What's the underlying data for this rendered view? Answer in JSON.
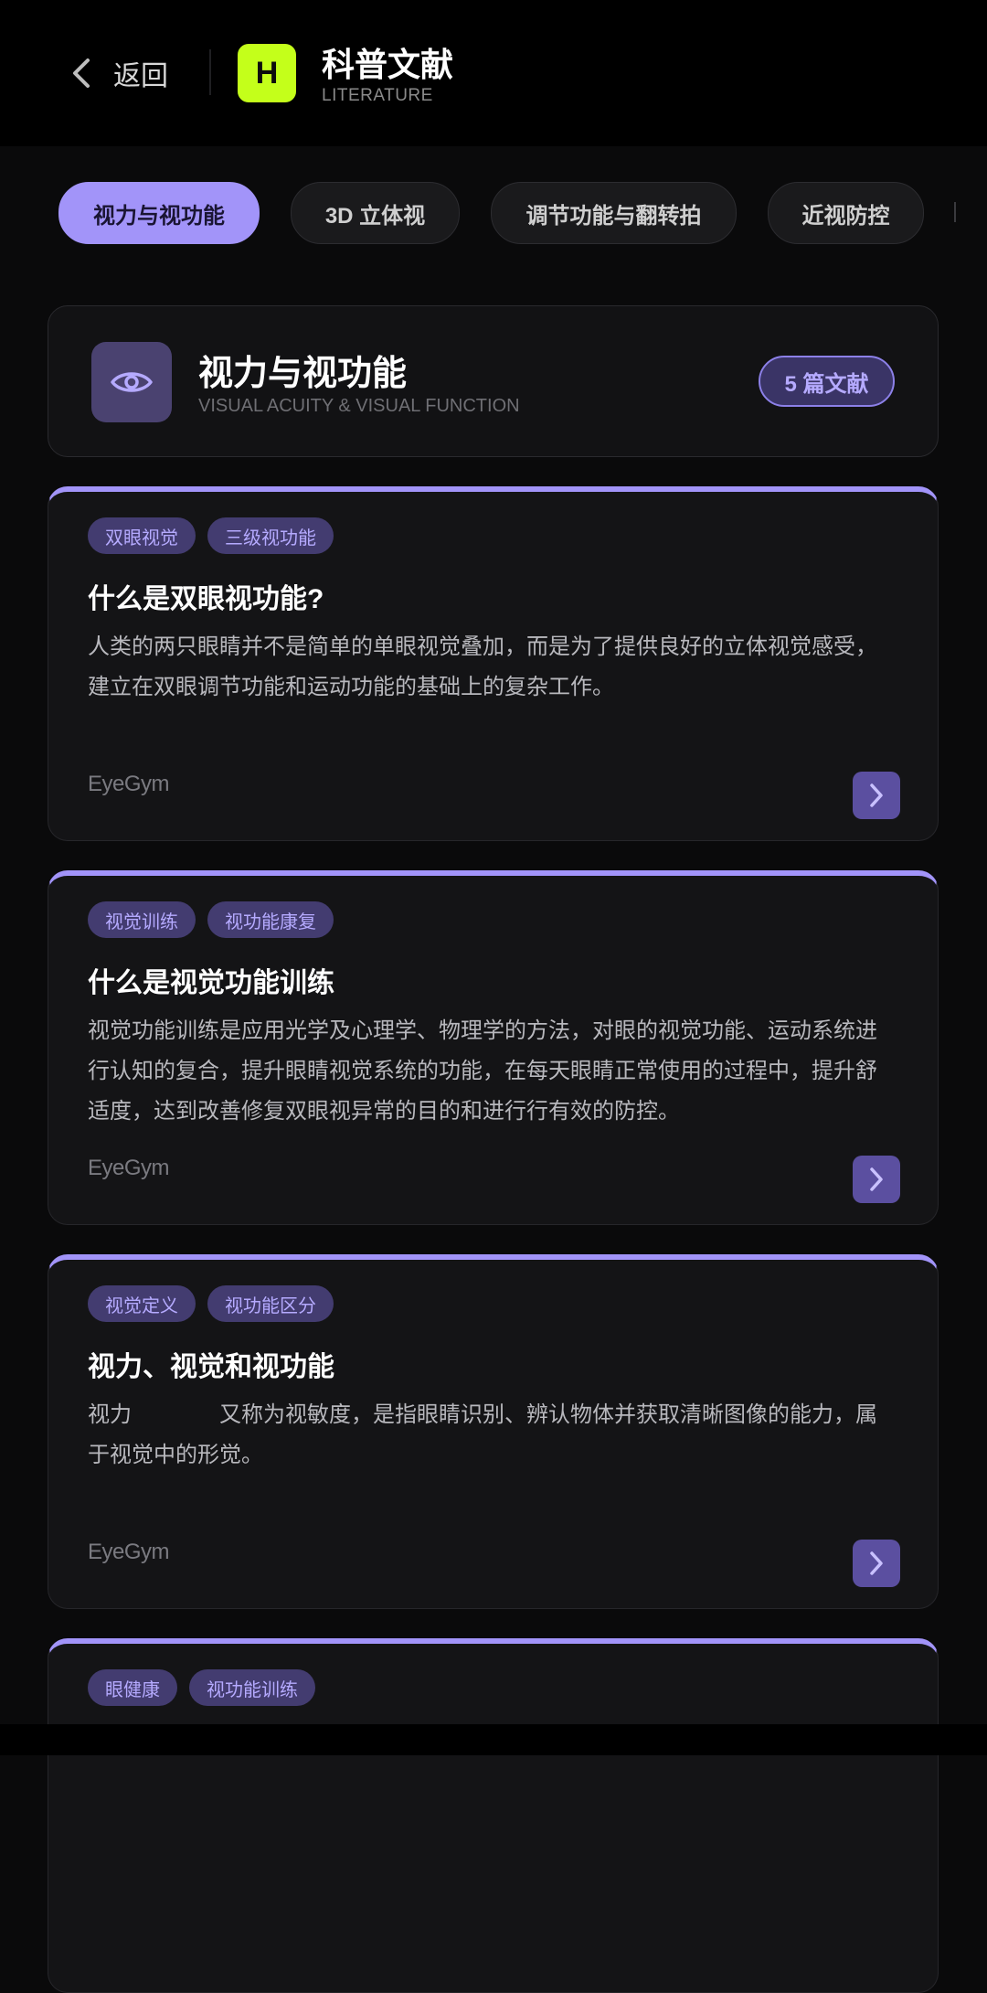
{
  "header": {
    "back_label": "返回",
    "logo_letter": "H",
    "title": "科普文献",
    "subtitle": "LITERATURE"
  },
  "colors": {
    "accent": "#a294f9",
    "logo": "#c4ff1a",
    "background": "#0a0a0b"
  },
  "tabs": [
    {
      "label": "视力与视功能",
      "active": true
    },
    {
      "label": "3D 立体视",
      "active": false
    },
    {
      "label": "调节功能与翻转拍",
      "active": false
    },
    {
      "label": "近视防控",
      "active": false
    }
  ],
  "category": {
    "icon": "eye-icon",
    "title": "视力与视功能",
    "subtitle": "VISUAL ACUITY & VISUAL FUNCTION",
    "count_badge": "5 篇文献"
  },
  "articles": [
    {
      "tags": [
        "双眼视觉",
        "三级视功能"
      ],
      "title": "什么是双眼视功能?",
      "body": "人类的两只眼睛并不是简单的单眼视觉叠加，而是为了提供良好的立体视觉感受，建立在双眼调节功能和运动功能的基础上的复杂工作。",
      "brand": "EyeGym"
    },
    {
      "tags": [
        "视觉训练",
        "视功能康复"
      ],
      "title": "什么是视觉功能训练",
      "body": "视觉功能训练是应用光学及心理学、物理学的方法，对眼的视觉功能、运动系统进行认知的复合，提升眼睛视觉系统的功能，在每天眼睛正常使用的过程中，提升舒适度，达到改善修复双眼视异常的目的和进行行有效的防控。",
      "brand": "EyeGym"
    },
    {
      "tags": [
        "视觉定义",
        "视功能区分"
      ],
      "title": "视力、视觉和视功能",
      "body": "视力　　　　又称为视敏度，是指眼睛识别、辨认物体并获取清晰图像的能力，属于视觉中的形觉。",
      "brand": "EyeGym"
    },
    {
      "tags": [
        "眼健康",
        "视功能训练"
      ],
      "title": "",
      "body": "",
      "brand": ""
    }
  ]
}
